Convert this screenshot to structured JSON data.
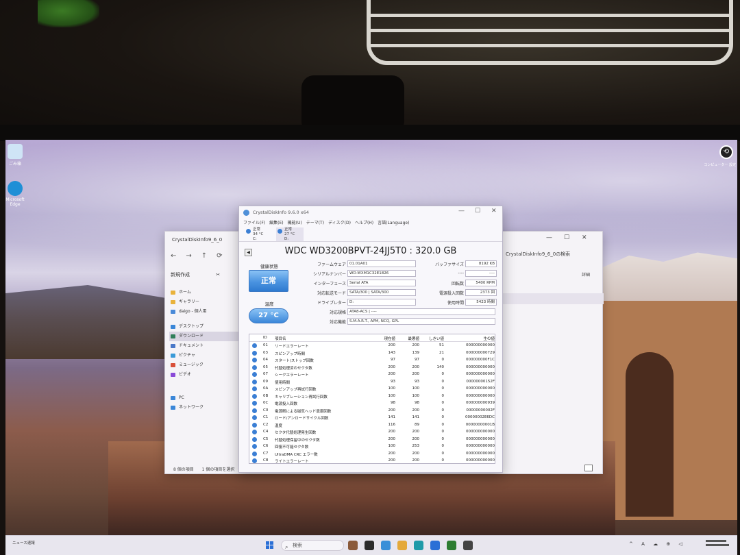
{
  "desktop": {
    "icons": [
      {
        "label": "ごみ箱",
        "color": "#cfe4f6"
      },
      {
        "label": "Microsoft Edge",
        "color": "#1f8fd6"
      }
    ],
    "corner_label": "コンピューター 設定"
  },
  "explorer": {
    "title": "CrystalDiskInfo9_6_0",
    "nav": "←→↑⟳",
    "toolbar_new": "新規作成",
    "toolbar_cut": "✂",
    "search_placeholder": "CrystalDiskInfo9_6_0の検索",
    "details": "詳細",
    "sidebar": [
      {
        "label": "ホーム"
      },
      {
        "label": "ギャラリー"
      },
      {
        "label": "daigo - 個人用"
      },
      {
        "label": "デスクトップ"
      },
      {
        "label": "ダウンロード",
        "selected": true
      },
      {
        "label": "ドキュメント"
      },
      {
        "label": "ピクチャ"
      },
      {
        "label": "ミュージック"
      },
      {
        "label": "ビデオ"
      },
      {
        "label": "PC"
      },
      {
        "label": "ネットワーク"
      }
    ],
    "status_left": "8 個の項目",
    "status_sel": "1 個の項目を選択"
  },
  "cdi": {
    "title": "CrystalDiskInfo 9.6.0 x64",
    "menu": [
      "ファイル(F)",
      "編集(E)",
      "機能(U)",
      "テーマ(T)",
      "ディスク(D)",
      "ヘルプ(H)",
      "言語(Language)"
    ],
    "drives": [
      {
        "status": "正常",
        "temp": "34 °C",
        "letter": "C:"
      },
      {
        "status": "正常",
        "temp": "27 °C",
        "letter": "D:"
      }
    ],
    "model": "WDC WD3200BPVT-24JJ5T0 : 320.0 GB",
    "health_label": "健康状態",
    "health_value": "正常",
    "temp_label": "温度",
    "temp_value": "27 °C",
    "firmware_label": "ファームウェア",
    "firmware": "01.01A01",
    "serial_label": "シリアルナンバー",
    "serial": "WD-WXM1C32E1826",
    "interface_label": "インターフェース",
    "interface": "Serial ATA",
    "transfer_label": "対応転送モード",
    "transfer": "SATA/300 | SATA/300",
    "letter_label": "ドライブレター",
    "letter": "D:",
    "standard_label": "対応規格",
    "standard": "ATA8-ACS | ----",
    "features_label": "対応機能",
    "features": "S.M.A.R.T., APM, NCQ, GPL",
    "buffer_label": "バッファサイズ",
    "buffer": "8192 KB",
    "blank_label": "----",
    "blank": "----",
    "rpm_label": "回転数",
    "rpm": "5400 RPM",
    "count_label": "電源投入回数",
    "count": "2373 回",
    "hours_label": "使用時間",
    "hours": "5423 時間",
    "smart_headers": {
      "id": "ID",
      "name": "項目名",
      "cur": "現在値",
      "wor": "最悪値",
      "thr": "しきい値",
      "raw": "生の値"
    },
    "smart": [
      {
        "id": "01",
        "name": "リードエラーレート",
        "cur": "200",
        "wor": "200",
        "thr": "51",
        "raw": "000000000000"
      },
      {
        "id": "03",
        "name": "スピンアップ時間",
        "cur": "143",
        "wor": "139",
        "thr": "21",
        "raw": "000000000729"
      },
      {
        "id": "04",
        "name": "スタート/ストップ回数",
        "cur": "97",
        "wor": "97",
        "thr": "0",
        "raw": "000000000F1C"
      },
      {
        "id": "05",
        "name": "代替処理済のセクタ数",
        "cur": "200",
        "wor": "200",
        "thr": "140",
        "raw": "000000000000"
      },
      {
        "id": "07",
        "name": "シークエラーレート",
        "cur": "200",
        "wor": "200",
        "thr": "0",
        "raw": "000000000000"
      },
      {
        "id": "09",
        "name": "使用時間",
        "cur": "93",
        "wor": "93",
        "thr": "0",
        "raw": "00000000152F"
      },
      {
        "id": "0A",
        "name": "スピンアップ再試行回数",
        "cur": "100",
        "wor": "100",
        "thr": "0",
        "raw": "000000000000"
      },
      {
        "id": "0B",
        "name": "キャリブレーション再試行回数",
        "cur": "100",
        "wor": "100",
        "thr": "0",
        "raw": "000000000000"
      },
      {
        "id": "0C",
        "name": "電源投入回数",
        "cur": "98",
        "wor": "98",
        "thr": "0",
        "raw": "000000000939"
      },
      {
        "id": "C0",
        "name": "電源断による磁気ヘッド退避回数",
        "cur": "200",
        "wor": "200",
        "thr": "0",
        "raw": "00000000002F"
      },
      {
        "id": "C1",
        "name": "ロード/アンロードサイクル回数",
        "cur": "141",
        "wor": "141",
        "thr": "0",
        "raw": "00000002E6DC"
      },
      {
        "id": "C2",
        "name": "温度",
        "cur": "116",
        "wor": "89",
        "thr": "0",
        "raw": "00000000001B"
      },
      {
        "id": "C4",
        "name": "セクタ代替処理発生回数",
        "cur": "200",
        "wor": "200",
        "thr": "0",
        "raw": "000000000000"
      },
      {
        "id": "C5",
        "name": "代替処理保留中のセクタ数",
        "cur": "200",
        "wor": "200",
        "thr": "0",
        "raw": "000000000000"
      },
      {
        "id": "C6",
        "name": "回復不可能セクタ数",
        "cur": "100",
        "wor": "253",
        "thr": "0",
        "raw": "000000000000"
      },
      {
        "id": "C7",
        "name": "UltraDMA CRC エラー数",
        "cur": "200",
        "wor": "200",
        "thr": "0",
        "raw": "000000000000"
      },
      {
        "id": "C8",
        "name": "ライトエラーレート",
        "cur": "200",
        "wor": "200",
        "thr": "0",
        "raw": "000000000000"
      }
    ]
  },
  "taskbar": {
    "news": "ニュース速報",
    "search": "検索",
    "tray": "^ A ☁ ⊕ ◁",
    "apps": [
      {
        "color": "#8a5a3a"
      },
      {
        "color": "#2b2b2b"
      },
      {
        "color": "#3a8fd8"
      },
      {
        "color": "#e4a93a"
      },
      {
        "color": "#1f9aa8"
      },
      {
        "color": "#2a6fd6"
      },
      {
        "color": "#2e7d32"
      },
      {
        "color": "#444444"
      }
    ]
  }
}
